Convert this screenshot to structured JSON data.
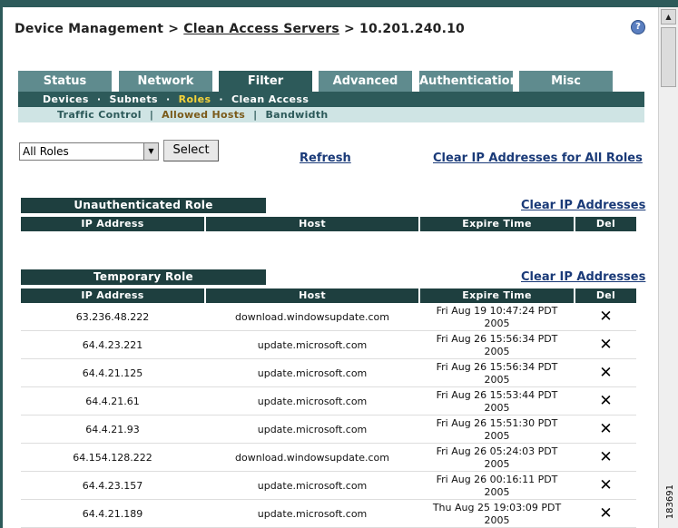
{
  "breadcrumb": {
    "part1": "Device Management",
    "sep": ">",
    "part2": "Clean Access Servers",
    "part3": "10.201.240.10"
  },
  "tabs": [
    "Status",
    "Network",
    "Filter",
    "Advanced",
    "Authentication",
    "Misc"
  ],
  "active_tab": "Filter",
  "subnav": {
    "items": [
      "Devices",
      "Subnets",
      "Roles",
      "Clean Access"
    ],
    "separator": "·",
    "active": "Roles"
  },
  "subnav2": {
    "items": [
      "Traffic Control",
      "Allowed Hosts",
      "Bandwidth"
    ],
    "separator": "|",
    "active": "Allowed Hosts"
  },
  "controls": {
    "role_select_value": "All Roles",
    "select_button": "Select",
    "refresh_link": "Refresh",
    "clear_all_link": "Clear IP Addresses for All Roles"
  },
  "columns": [
    "IP Address",
    "Host",
    "Expire Time",
    "Del"
  ],
  "roles": [
    {
      "title": "Unauthenticated Role",
      "clear_link": "Clear IP Addresses",
      "rows": []
    },
    {
      "title": "Temporary Role",
      "clear_link": "Clear IP Addresses",
      "rows": [
        {
          "ip": "63.236.48.222",
          "host": "download.windowsupdate.com",
          "expire1": "Fri Aug 19 10:47:24 PDT",
          "expire2": "2005"
        },
        {
          "ip": "64.4.23.221",
          "host": "update.microsoft.com",
          "expire1": "Fri Aug 26 15:56:34 PDT",
          "expire2": "2005"
        },
        {
          "ip": "64.4.21.125",
          "host": "update.microsoft.com",
          "expire1": "Fri Aug 26 15:56:34 PDT",
          "expire2": "2005"
        },
        {
          "ip": "64.4.21.61",
          "host": "update.microsoft.com",
          "expire1": "Fri Aug 26 15:53:44 PDT",
          "expire2": "2005"
        },
        {
          "ip": "64.4.21.93",
          "host": "update.microsoft.com",
          "expire1": "Fri Aug 26 15:51:30 PDT",
          "expire2": "2005"
        },
        {
          "ip": "64.154.128.222",
          "host": "download.windowsupdate.com",
          "expire1": "Fri Aug 26 05:24:03 PDT",
          "expire2": "2005"
        },
        {
          "ip": "64.4.23.157",
          "host": "update.microsoft.com",
          "expire1": "Fri Aug 26 00:16:11 PDT",
          "expire2": "2005"
        },
        {
          "ip": "64.4.21.189",
          "host": "update.microsoft.com",
          "expire1": "Thu Aug 25 19:03:09 PDT",
          "expire2": "2005"
        }
      ]
    }
  ],
  "delete_glyph": "✕",
  "icons": {
    "help": "help-circle-icon",
    "delete": "close-icon"
  },
  "figure_id": "183691",
  "colors": {
    "dark_teal": "#1e3f3f",
    "teal": "#2d5a5a",
    "tab": "#5f8b8e",
    "subnav_light": "#cfe4e4",
    "link": "#1a3a78",
    "active_sub": "#f5d33a"
  }
}
